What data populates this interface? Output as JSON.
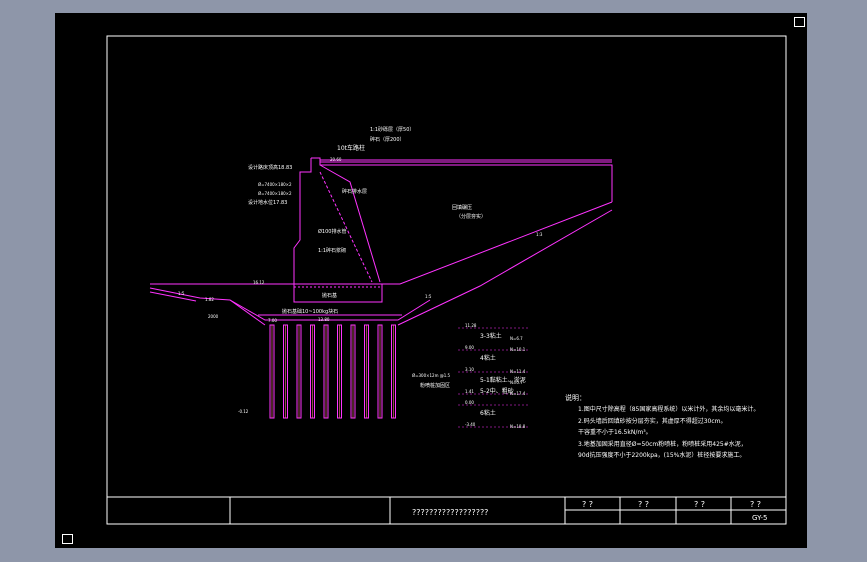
{
  "drawing": {
    "labels": {
      "top_layer_1": "1:1砂砾层（厚50）",
      "top_layer_2": "碎石（厚200）",
      "road_top": "10t车路柱",
      "top_dim": "20.60",
      "design_top": "设计路床顶高18.83",
      "filter_1": "Ø=7400×180×2",
      "filter_2": "Ø=7400×180×2",
      "design_water": "设计地水位17.83",
      "drain": "碎石排水层",
      "backfill": "回填碾压",
      "backfill_2": "（分层夯实）",
      "pipe": "Ø100排水管",
      "slope_mark": "1:0.35",
      "drain_2": "1:1碎石浆砌",
      "bed_label": "抛石基",
      "base_elev": "16.12",
      "ground_level": "15.60",
      "slope_1": "1:5",
      "slope_2": "1:5",
      "left_slope": "1:5",
      "left_dim": "1.82",
      "mid_dim": "13.80",
      "bed_text": "抛石基础10~100kg块石",
      "pile_top": "7.00",
      "small_1": "2000",
      "small_2": "1.5",
      "right_slope": "1:3",
      "pile_note": "Ø=300×12m @1.5",
      "pile_note_2": "粉喷桩加固区",
      "bottom_elev": "-0.12"
    },
    "soil_layers": [
      {
        "elev": "11.28",
        "name": "",
        "n": ""
      },
      {
        "elev": "",
        "name": "3-3粘土",
        "n": "N=6.7"
      },
      {
        "elev": "9.00",
        "name": "",
        "n": "N=10.1"
      },
      {
        "elev": "",
        "name": "4粘土",
        "n": ""
      },
      {
        "elev": "3.10",
        "name": "",
        "n": "N=11.4"
      },
      {
        "elev": "",
        "name": "5-1黏粘土、淤泥",
        "n": "N=5.7"
      },
      {
        "elev": "1.41",
        "name": "5-2中、粗砂",
        "n": "N=17.4"
      },
      {
        "elev": "0.00",
        "name": "",
        "n": ""
      },
      {
        "elev": "",
        "name": "6粘土",
        "n": ""
      },
      {
        "elev": "-3.40",
        "name": "",
        "n": "N=18.8"
      }
    ],
    "notes_title": "说明：",
    "notes": [
      "1.图中尺寸除高程（85国家高程系统）以米计外，其余均以毫米计。",
      "2.码头墙后回填砂按分层夯实，其虚厚不得超过30cm。",
      "   干容重不小于16.5kN/m³。",
      "3.地基加固采用直径Ø=50cm粉喷桩，粉喷桩采用425#水泥，",
      "   90d抗压强度不小于2200kpa，(15%水泥）桩径按要求施工。"
    ]
  },
  "title_block": {
    "title": "??????????????????",
    "cells": [
      "?  ?",
      "?  ?",
      "?  ?",
      "?  ?"
    ],
    "drawing_no": "GY-5"
  },
  "colors": {
    "background": "#8e96a9",
    "canvas": "#000000",
    "frame": "#ffffff",
    "structure": "#ff00ff",
    "text": "#ffffff",
    "dimension": "#ff3030",
    "leader": "#00c8c8"
  }
}
